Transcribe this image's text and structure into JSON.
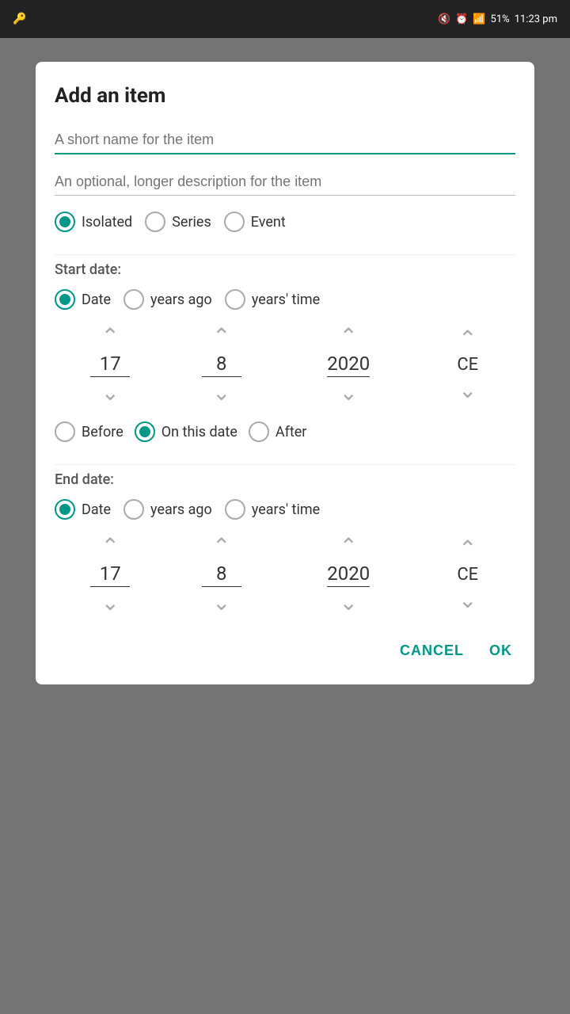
{
  "statusBar": {
    "time": "11:23 pm",
    "battery": "51%"
  },
  "dialog": {
    "title": "Add an item",
    "namePlaceholder": "A short name for the item",
    "descPlaceholder": "An optional, longer description for the item",
    "itemTypes": [
      {
        "label": "Isolated",
        "selected": true
      },
      {
        "label": "Series",
        "selected": false
      },
      {
        "label": "Event",
        "selected": false
      }
    ],
    "startDate": {
      "sectionLabel": "Start date:",
      "typeOptions": [
        {
          "label": "Date",
          "selected": true
        },
        {
          "label": "years ago",
          "selected": false
        },
        {
          "label": "years' time",
          "selected": false
        }
      ],
      "day": "17",
      "month": "8",
      "year": "2020",
      "era": "CE",
      "precision": [
        {
          "label": "Before",
          "selected": false
        },
        {
          "label": "On this date",
          "selected": true
        },
        {
          "label": "After",
          "selected": false
        }
      ]
    },
    "endDate": {
      "sectionLabel": "End date:",
      "typeOptions": [
        {
          "label": "Date",
          "selected": true
        },
        {
          "label": "years ago",
          "selected": false
        },
        {
          "label": "years' time",
          "selected": false
        }
      ],
      "day": "17",
      "month": "8",
      "year": "2020",
      "era": "CE"
    },
    "cancelLabel": "CANCEL",
    "okLabel": "OK"
  }
}
